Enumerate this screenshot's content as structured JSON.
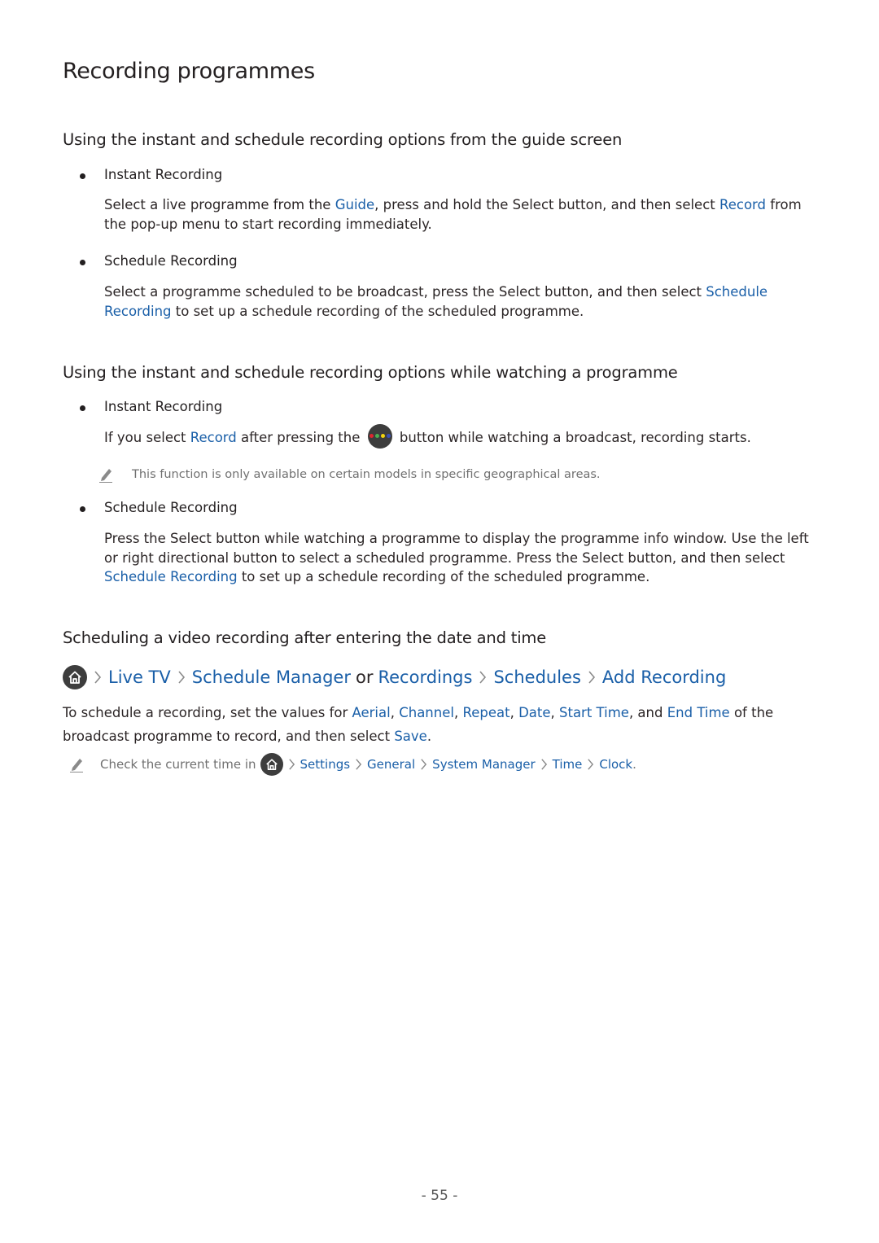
{
  "page_title": "Recording programmes",
  "colors": {
    "link": "#1a5fa8",
    "text": "#231f20",
    "note": "#707070",
    "icon_bg": "#3d3d3d",
    "color_button_dots": [
      "#e0262f",
      "#4caf50",
      "#f2d30f",
      "#3a4fb5"
    ]
  },
  "section1": {
    "heading": "Using the instant and schedule recording options from the guide screen",
    "items": [
      {
        "title": "Instant Recording",
        "text": [
          "Select a live programme from the ",
          "Guide",
          ", press and hold the Select button, and then select ",
          "Record",
          " from the pop-up menu to start recording immediately."
        ]
      },
      {
        "title": "Schedule Recording",
        "text": [
          "Select a programme scheduled to be broadcast, press the Select button, and then select ",
          "Schedule Recording",
          " to set up a schedule recording of the scheduled programme."
        ]
      }
    ]
  },
  "section2": {
    "heading": "Using the instant and schedule recording options while watching a programme",
    "items": [
      {
        "title": "Instant Recording",
        "text": [
          "If you select ",
          "Record",
          " after pressing the ",
          " button while watching a broadcast, recording starts."
        ],
        "icon": "color-button-icon",
        "note": "This function is only available on certain models in specific geographical areas."
      },
      {
        "title": "Schedule Recording",
        "text": [
          "Press the Select button while watching a programme to display the programme info window. Use the left or right directional button to select a scheduled programme. Press the Select button, and then select ",
          "Schedule Recording",
          " to set up a schedule recording of the scheduled programme."
        ]
      }
    ]
  },
  "section3": {
    "heading": "Scheduling a video recording after entering the date and time",
    "path": {
      "icon": "home-icon",
      "items": [
        "Live TV",
        "Schedule Manager",
        "or",
        "Recordings",
        "Schedules",
        "Add Recording"
      ]
    },
    "text": [
      "To schedule a recording, set the values for ",
      "Aerial",
      ", ",
      "Channel",
      ", ",
      "Repeat",
      ", ",
      "Date",
      ", ",
      "Start Time",
      ", and ",
      "End Time",
      " of the broadcast programme to record, and then select ",
      "Save",
      "."
    ],
    "note": {
      "prefix": "Check the current time in",
      "path": [
        "Settings",
        "General",
        "System Manager",
        "Time",
        "Clock"
      ],
      "suffix": "."
    }
  },
  "page_number": "- 55 -"
}
